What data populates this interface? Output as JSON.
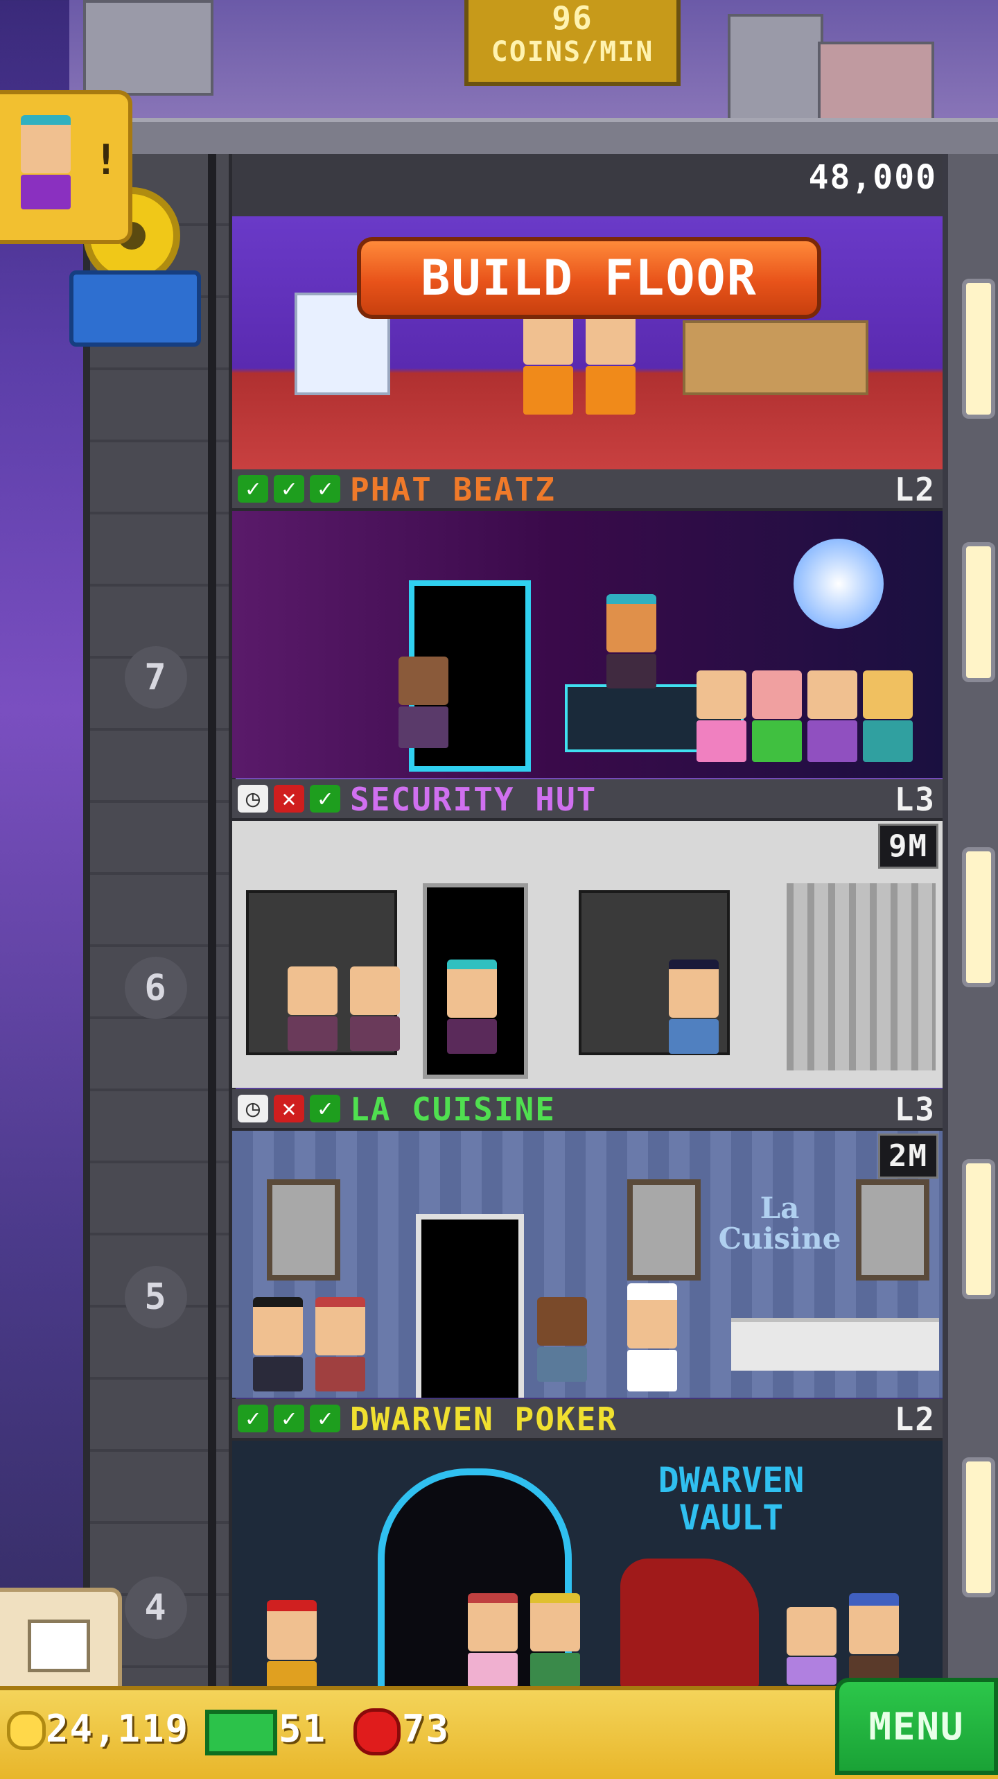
{
  "hud": {
    "coins_per_min_value": "96",
    "coins_per_min_label": "COINS/MIN"
  },
  "build": {
    "button_label": "BUILD FLOOR",
    "cost": "48,000"
  },
  "floors": [
    {
      "name": "PHAT BEATZ",
      "level": "L2",
      "floor_number": "7",
      "title_color": "#f07a2a",
      "status": [
        "check",
        "check",
        "check"
      ],
      "stock": ""
    },
    {
      "name": "SECURITY HUT",
      "level": "L3",
      "floor_number": "6",
      "title_color": "#d070f0",
      "status": [
        "clock",
        "x",
        "check"
      ],
      "stock": "9M"
    },
    {
      "name": "LA CUISINE",
      "level": "L3",
      "floor_number": "5",
      "title_color": "#50e050",
      "status": [
        "clock",
        "x",
        "check"
      ],
      "stock": "2M"
    },
    {
      "name": "DWARVEN POKER",
      "level": "L2",
      "floor_number": "4",
      "title_color": "#f0e030",
      "status": [
        "check",
        "check",
        "check"
      ],
      "stock": ""
    }
  ],
  "signs": {
    "la_cuisine": "La Cuisine",
    "dwarven_vault": "DWARVEN VAULT"
  },
  "resources": {
    "coins": "24,119",
    "bux": "51",
    "gems": "73"
  },
  "menu_label": "MENU"
}
